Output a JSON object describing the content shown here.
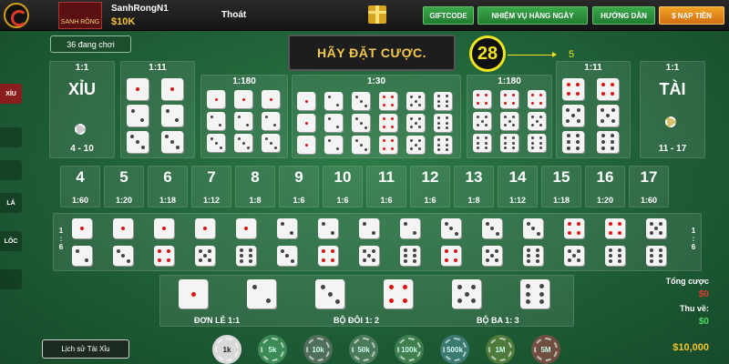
{
  "header": {
    "username": "SanhRongN1",
    "balance": "$10K",
    "logout": "Thoát",
    "logo_text": "SANH RỒNG",
    "buttons": [
      {
        "label": "GIFTCODE"
      },
      {
        "label": "NHIỆM VỤ HÀNG NGÀY"
      },
      {
        "label": "HƯỚNG DẪN"
      },
      {
        "label": "$ NẠP TIỀN"
      }
    ]
  },
  "game": {
    "players_online": "36 đang chơi",
    "status": "HÃY ĐẶT CƯỢC.",
    "timer": "28",
    "timer_sub": "5"
  },
  "bets": {
    "xiu": {
      "ratio": "1:1",
      "label": "XỈU",
      "range": "4 - 10"
    },
    "tai": {
      "ratio": "1:1",
      "label": "TÀI",
      "range": "11 - 17"
    },
    "double_left_ratio": "1:11",
    "double_right_ratio": "1:11",
    "triple_left_ratio": "1:180",
    "triple_right_ratio": "1:180",
    "any_triple_ratio": "1:30",
    "sums": [
      {
        "num": "4",
        "ratio": "1:60"
      },
      {
        "num": "5",
        "ratio": "1:20"
      },
      {
        "num": "6",
        "ratio": "1:18"
      },
      {
        "num": "7",
        "ratio": "1:12"
      },
      {
        "num": "8",
        "ratio": "1:8"
      },
      {
        "num": "9",
        "ratio": "1:6"
      },
      {
        "num": "10",
        "ratio": "1:6"
      },
      {
        "num": "11",
        "ratio": "1:6"
      },
      {
        "num": "12",
        "ratio": "1:6"
      },
      {
        "num": "13",
        "ratio": "1:8"
      },
      {
        "num": "14",
        "ratio": "1:12"
      },
      {
        "num": "15",
        "ratio": "1:18"
      },
      {
        "num": "16",
        "ratio": "1:20"
      },
      {
        "num": "17",
        "ratio": "1:60"
      }
    ],
    "pair_side_ratio_left": [
      "1",
      ":",
      "6"
    ],
    "pair_side_ratio_right": [
      "1",
      ":",
      "6"
    ],
    "single_label": "ĐƠN LẺ 1:1",
    "double_label": "BỘ ĐÔI 1: 2",
    "triple_label": "BỘ BA 1: 3"
  },
  "summary": {
    "total_bet_label": "Tổng cược",
    "total_bet_value": "$0",
    "refund_label": "Thu về:",
    "refund_value": "$0"
  },
  "footer": {
    "history": "Lịch sử Tài Xỉu",
    "chips": [
      {
        "label": "1k",
        "color": "#d9d9d9"
      },
      {
        "label": "5k",
        "color": "#3c8a55"
      },
      {
        "label": "10k",
        "color": "#4f6f5a"
      },
      {
        "label": "50k",
        "color": "#4a7a5a"
      },
      {
        "label": "100k",
        "color": "#3f7f4f"
      },
      {
        "label": "500k",
        "color": "#3a7a70"
      },
      {
        "label": "1M",
        "color": "#4e7a3b"
      },
      {
        "label": "5M",
        "color": "#6f5040"
      }
    ],
    "wallet": "$10,000"
  },
  "left_tabs": [
    "XỈU",
    "",
    "",
    "LÁ",
    "LỐC",
    ""
  ]
}
